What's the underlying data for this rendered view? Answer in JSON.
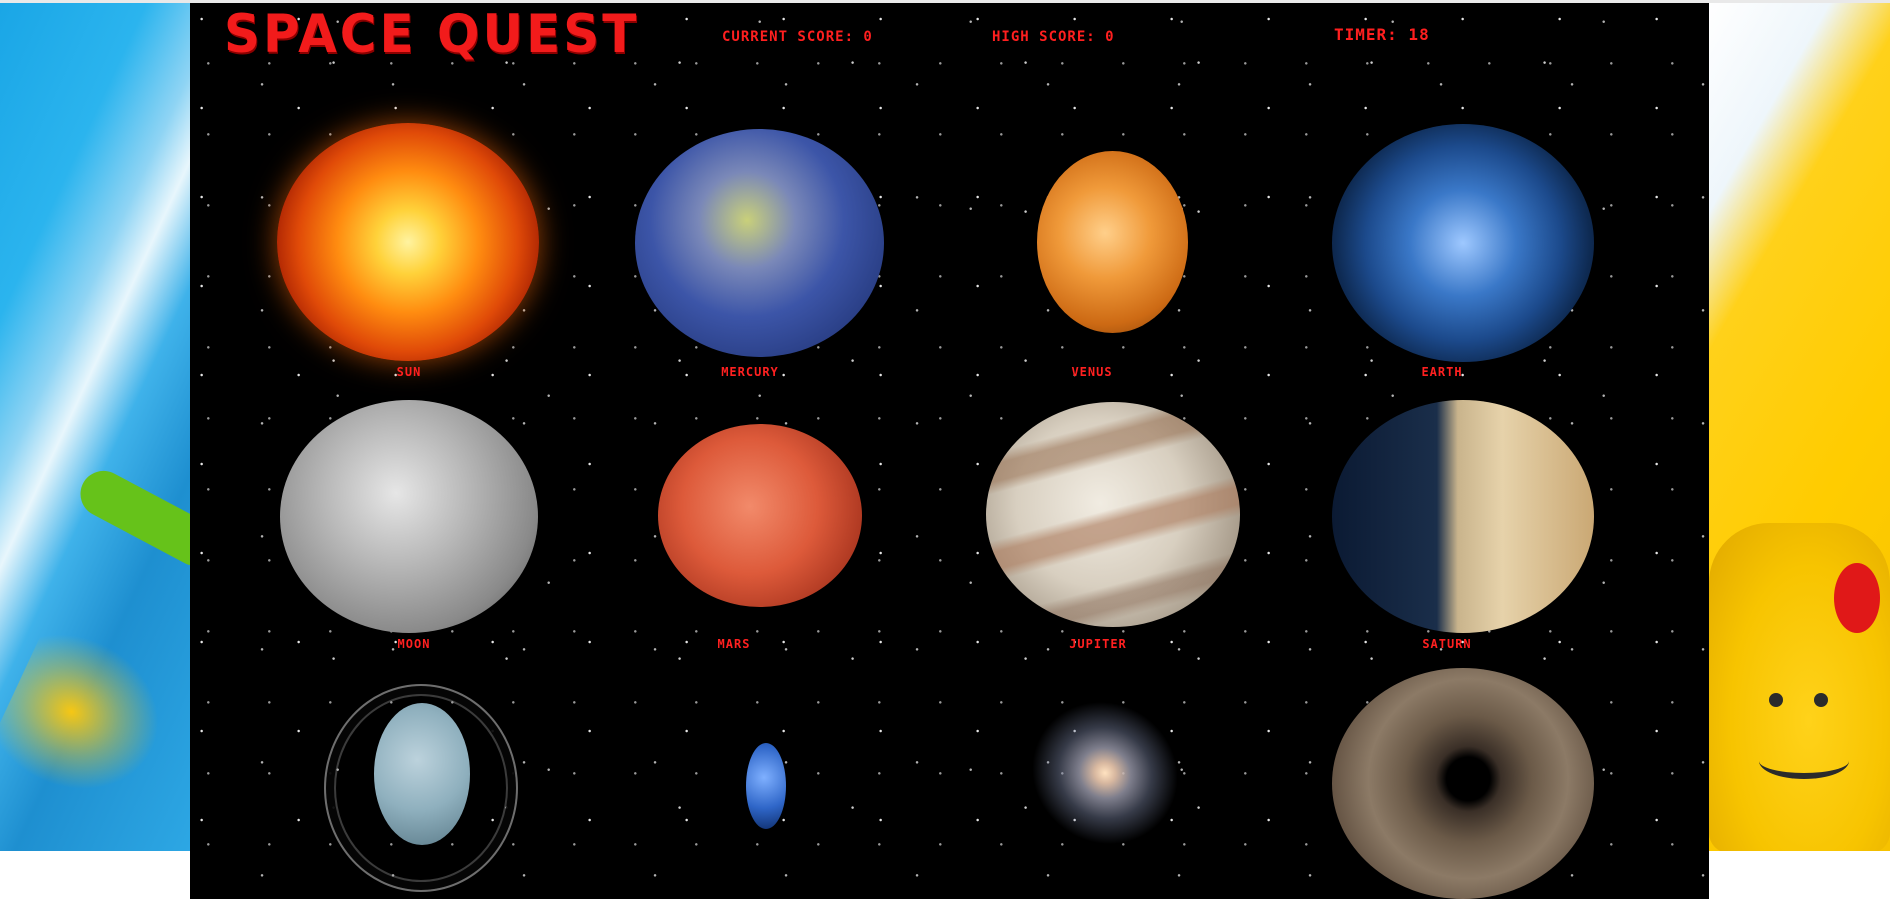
{
  "game": {
    "title": "Space Quest",
    "current_score": "Current Score: 0",
    "high_score": "High Score: 0",
    "timer": "Timer: 18"
  },
  "bodies": [
    {
      "label": "Sun",
      "icon": "sun-icon"
    },
    {
      "label": "Mercury",
      "icon": "mercury-icon"
    },
    {
      "label": "Venus",
      "icon": "venus-icon"
    },
    {
      "label": "Earth",
      "icon": "earth-icon"
    },
    {
      "label": "Moon",
      "icon": "moon-icon"
    },
    {
      "label": "Mars",
      "icon": "mars-icon"
    },
    {
      "label": "Jupiter",
      "icon": "jupiter-icon"
    },
    {
      "label": "Saturn",
      "icon": "saturn-icon"
    },
    {
      "label": "",
      "icon": "uranus-icon"
    },
    {
      "label": "",
      "icon": "neptune-icon"
    },
    {
      "label": "",
      "icon": "galaxy-icon"
    },
    {
      "label": "",
      "icon": "black-hole-icon"
    }
  ],
  "colors": {
    "accent": "#f21b1b",
    "background": "#000000"
  }
}
